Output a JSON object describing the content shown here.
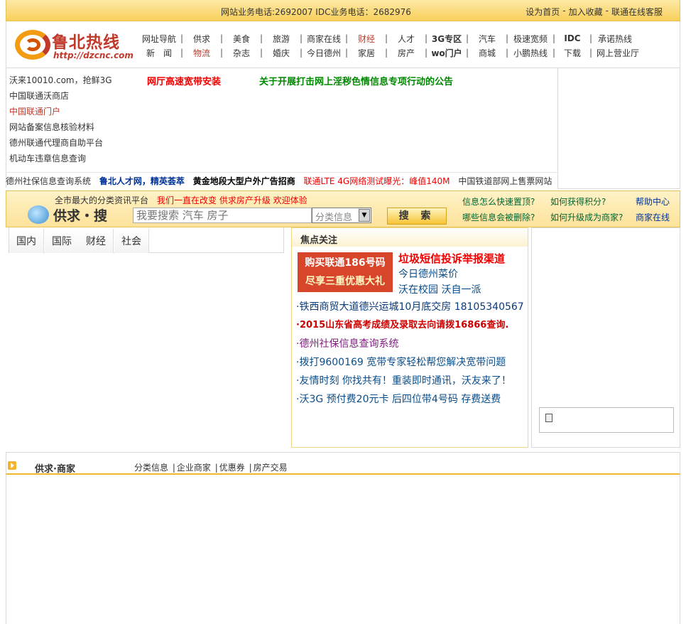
{
  "topbar": {
    "phone_text": "网站业务电话:2692007 IDC业务电话：2682976",
    "links": [
      "设为首页",
      "加入收藏",
      "联通在线客服"
    ]
  },
  "logo": {
    "name": "鲁北热线",
    "url": "http://dzcnc.com"
  },
  "nav": {
    "row1": [
      "网址导航",
      "供求",
      "美食",
      "旅游",
      "商家在线",
      "财经",
      "人才",
      "3G专区",
      "汽车",
      "极速宽频",
      "IDC",
      "承诺热线"
    ],
    "row2": [
      "新　闻",
      "物流",
      "杂志",
      "婚庆",
      "今日德州",
      "家居",
      "房产",
      "wo门户",
      "商城",
      "小鹏热线",
      "下载",
      "网上营业厅"
    ]
  },
  "news": {
    "left_links": [
      "沃来10010.com，抢鲜3G",
      "中国联通沃商店",
      "中国联通门户",
      "网站备案信息核验材料",
      "德州联通代理商自助平台",
      "机动车违章信息查询"
    ],
    "headline_red": "网厅高速宽带安装",
    "headline_green": "关于开展打击网上淫秽色情信息专项行动的公告"
  },
  "ticker": {
    "items": [
      "德州社保信息查询系统",
      "鲁北人才网，精英荟萃",
      "黄金地段大型户外广告招商",
      "联通LTE 4G网络测试曝光：峰值140M",
      "中国铁道部网上售票网站"
    ]
  },
  "search": {
    "slogan": "全市最大的分类资讯平台",
    "slogan_red": "我们一直在改变 供求房产升级 欢迎体验",
    "brand": "供求・搜",
    "placeholder": "我要搜索 汽车 房子",
    "category": "分类信息",
    "button": "搜 索",
    "help": [
      "信息怎么快速置顶?",
      "如何获得积分?",
      "帮助中心",
      "哪些信息会被删除?",
      "如何升级成为商家?",
      "商家在线"
    ]
  },
  "tabs": [
    "国内",
    "国际",
    "财经",
    "社会"
  ],
  "focus": {
    "title": "焦点关注",
    "ad_line1": "购买联通186号码",
    "ad_line2": "尽享三重优惠大礼",
    "spam": "垃圾短信投诉举报渠道",
    "link1": "今日德州菜价",
    "link2": "沃在校园  沃自一派",
    "items": [
      "·铁西商贸大道德兴运城10月底交房  18105340567",
      "·2015山东省高考成绩及录取去向请拨16866查询.",
      "·德州社保信息查询系统",
      "·拨打9600169 宽带专家轻松帮您解决宽带问题",
      "·友情时刻  你找共有！重装即时通讯，沃友来了！",
      "·沃3G 预付费20元卡  后四位带4号码  存费送费"
    ]
  },
  "supply_bar": {
    "title": "供求·商家",
    "links": [
      "分类信息",
      "企业商家",
      "优惠券",
      "房产交易"
    ]
  }
}
